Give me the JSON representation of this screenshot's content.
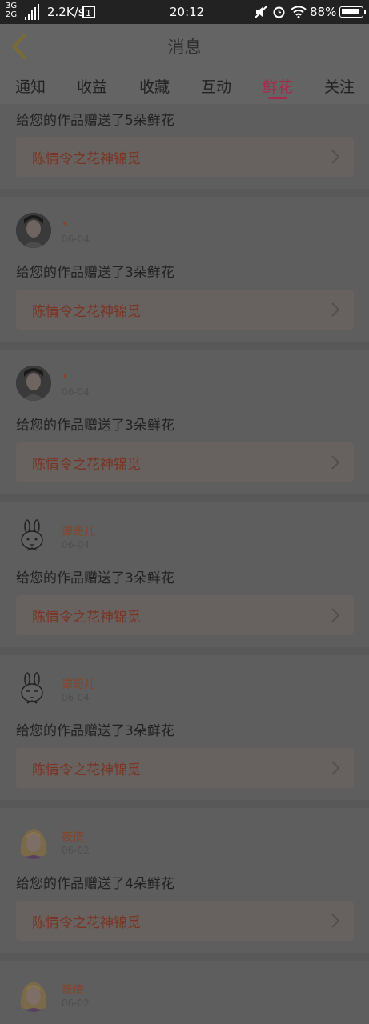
{
  "status_bar": {
    "network": "3G\n2G",
    "speed": "2.2K/s",
    "time": "20:12",
    "battery": "88%"
  },
  "header": {
    "title": "消息"
  },
  "tabs": [
    "通知",
    "收益",
    "收藏",
    "互动",
    "鲜花",
    "关注"
  ],
  "active_tab": "鲜花",
  "messages": [
    {
      "name": "",
      "date": "",
      "text": "给您的作品赠送了5朵鲜花",
      "work": "陈情令之花神锦觅"
    },
    {
      "name": "•",
      "date": "06-04",
      "text": "给您的作品赠送了3朵鲜花",
      "work": "陈情令之花神锦觅"
    },
    {
      "name": "•",
      "date": "06-04",
      "text": "给您的作品赠送了3朵鲜花",
      "work": "陈情令之花神锦觅"
    },
    {
      "name": "谭哥儿",
      "date": "06-04",
      "text": "给您的作品赠送了3朵鲜花",
      "work": "陈情令之花神锦觅"
    },
    {
      "name": "谭哥儿",
      "date": "06-04",
      "text": "给您的作品赠送了3朵鲜花",
      "work": "陈情令之花神锦觅"
    },
    {
      "name": "筱倩",
      "date": "06-02",
      "text": "给您的作品赠送了4朵鲜花",
      "work": "陈情令之花神锦觅"
    },
    {
      "name": "筱倩",
      "date": "06-02",
      "text": "",
      "work": ""
    }
  ],
  "colors": {
    "accent": "#a52b4c",
    "name": "#8a4226",
    "work_title": "#7b3322"
  }
}
